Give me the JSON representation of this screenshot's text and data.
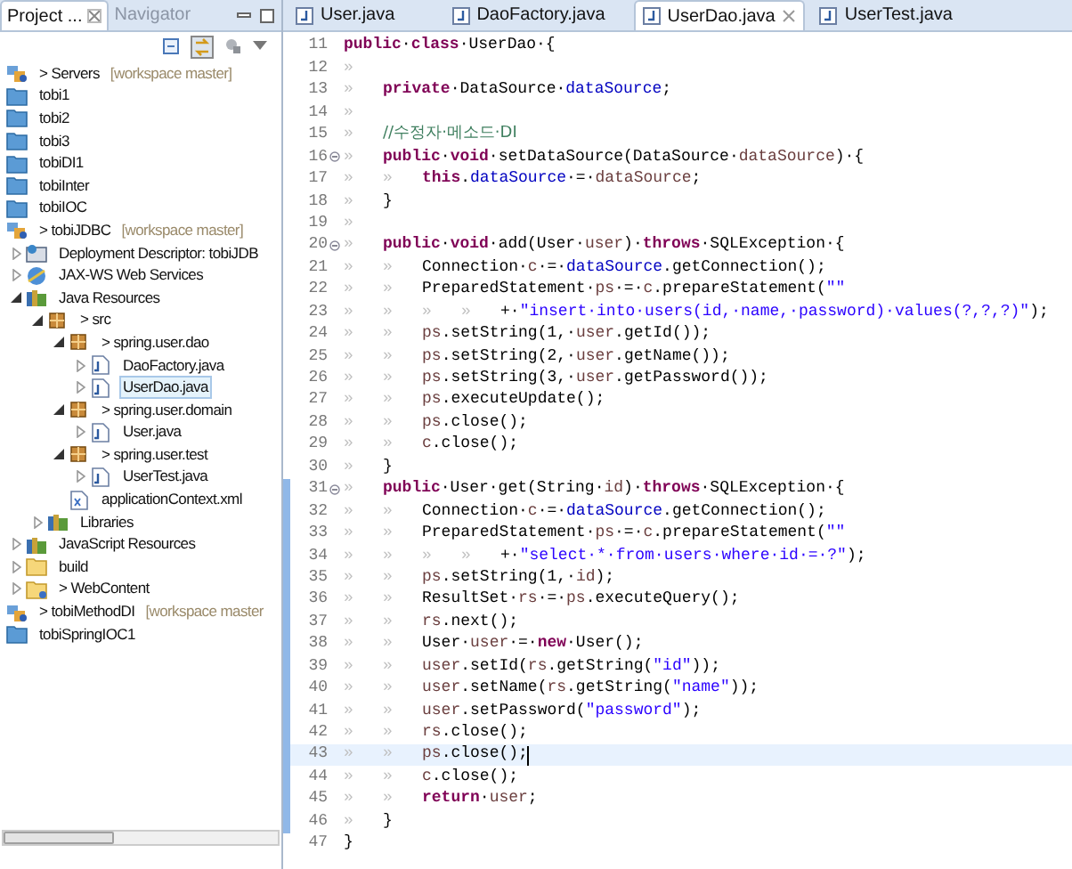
{
  "explorer": {
    "tabs": [
      {
        "label": "Project ...",
        "selected": true
      },
      {
        "label": "Navigator",
        "selected": false
      }
    ],
    "tree": [
      {
        "label": "> Servers",
        "suffix": "[workspace master]",
        "kind": "server-project"
      },
      {
        "label": "tobi1",
        "kind": "folder"
      },
      {
        "label": "tobi2",
        "kind": "folder"
      },
      {
        "label": "tobi3",
        "kind": "folder"
      },
      {
        "label": "tobiDI1",
        "kind": "folder"
      },
      {
        "label": "tobiInter",
        "kind": "folder"
      },
      {
        "label": "tobiIOC",
        "kind": "folder"
      },
      {
        "label": "> tobiJDBC",
        "suffix": "[workspace master]",
        "kind": "web-project",
        "children": [
          {
            "label": "Deployment Descriptor: tobiJDB",
            "kind": "descriptor",
            "expanded": false
          },
          {
            "label": "JAX-WS Web Services",
            "kind": "webservices",
            "expanded": false
          },
          {
            "label": "Java Resources",
            "kind": "java-resources",
            "expanded": true,
            "children": [
              {
                "label": "> src",
                "kind": "src",
                "expanded": true,
                "children": [
                  {
                    "label": "> spring.user.dao",
                    "kind": "package",
                    "expanded": true,
                    "children": [
                      {
                        "label": "DaoFactory.java",
                        "kind": "java-file",
                        "expanded": false,
                        "selected": false
                      },
                      {
                        "label": "UserDao.java",
                        "kind": "java-file",
                        "expanded": false,
                        "selected": true
                      }
                    ]
                  },
                  {
                    "label": "> spring.user.domain",
                    "kind": "package",
                    "expanded": true,
                    "children": [
                      {
                        "label": "User.java",
                        "kind": "java-file",
                        "expanded": false,
                        "selected": false
                      }
                    ]
                  },
                  {
                    "label": "> spring.user.test",
                    "kind": "package",
                    "expanded": true,
                    "children": [
                      {
                        "label": "UserTest.java",
                        "kind": "java-file",
                        "expanded": false,
                        "selected": false
                      }
                    ]
                  },
                  {
                    "label": "applicationContext.xml",
                    "kind": "xml-file"
                  }
                ]
              },
              {
                "label": "Libraries",
                "kind": "library",
                "expanded": false
              }
            ]
          },
          {
            "label": "JavaScript Resources",
            "kind": "library",
            "expanded": false
          },
          {
            "label": "build",
            "kind": "build-folder",
            "expanded": false
          },
          {
            "label": "> WebContent",
            "kind": "web-folder",
            "expanded": false
          }
        ]
      },
      {
        "label": "> tobiMethodDI",
        "suffix": "[workspace master",
        "kind": "server-project"
      },
      {
        "label": "tobiSpringIOC1",
        "kind": "folder"
      }
    ]
  },
  "editor": {
    "tabs": [
      {
        "label": "User.java",
        "selected": false
      },
      {
        "label": "DaoFactory.java",
        "selected": false
      },
      {
        "label": "UserDao.java",
        "selected": true
      },
      {
        "label": "UserTest.java",
        "selected": false
      }
    ],
    "lines": [
      {
        "number": "11",
        "fold": false,
        "range": false,
        "current": false,
        "tokens": [
          {
            "kind": "kw",
            "text": "public"
          },
          {
            "kind": "p",
            "text": "·"
          },
          {
            "kind": "kw",
            "text": "class"
          },
          {
            "kind": "p",
            "text": "·UserDao·{"
          }
        ]
      },
      {
        "number": "12",
        "fold": false,
        "range": false,
        "current": false,
        "tokens": [
          {
            "kind": "tab",
            "text": "»"
          }
        ]
      },
      {
        "number": "13",
        "fold": false,
        "range": false,
        "current": false,
        "tokens": [
          {
            "kind": "tab",
            "text": "»"
          },
          {
            "kind": "kw",
            "text": "private"
          },
          {
            "kind": "p",
            "text": "·DataSource·"
          },
          {
            "kind": "field",
            "text": "dataSource"
          },
          {
            "kind": "p",
            "text": ";"
          }
        ]
      },
      {
        "number": "14",
        "fold": false,
        "range": false,
        "current": false,
        "tokens": [
          {
            "kind": "tab",
            "text": "»"
          }
        ]
      },
      {
        "number": "15",
        "fold": false,
        "range": false,
        "current": false,
        "tokens": [
          {
            "kind": "tab",
            "text": "»"
          },
          {
            "kind": "cm",
            "text": "//수정자·메소드·DI"
          }
        ]
      },
      {
        "number": "16",
        "fold": true,
        "range": false,
        "current": false,
        "tokens": [
          {
            "kind": "tab",
            "text": "»"
          },
          {
            "kind": "kw",
            "text": "public"
          },
          {
            "kind": "p",
            "text": "·"
          },
          {
            "kind": "kw",
            "text": "void"
          },
          {
            "kind": "p",
            "text": "·setDataSource(DataSource·"
          },
          {
            "kind": "local",
            "text": "dataSource"
          },
          {
            "kind": "p",
            "text": ")·{"
          }
        ]
      },
      {
        "number": "17",
        "fold": false,
        "range": false,
        "current": false,
        "tokens": [
          {
            "kind": "tab",
            "text": "»"
          },
          {
            "kind": "tab",
            "text": "»"
          },
          {
            "kind": "kw",
            "text": "this"
          },
          {
            "kind": "p",
            "text": "."
          },
          {
            "kind": "field",
            "text": "dataSource"
          },
          {
            "kind": "p",
            "text": "·=·"
          },
          {
            "kind": "local",
            "text": "dataSource"
          },
          {
            "kind": "p",
            "text": ";"
          }
        ]
      },
      {
        "number": "18",
        "fold": false,
        "range": false,
        "current": false,
        "tokens": [
          {
            "kind": "tab",
            "text": "»"
          },
          {
            "kind": "p",
            "text": "}"
          }
        ]
      },
      {
        "number": "19",
        "fold": false,
        "range": false,
        "current": false,
        "tokens": [
          {
            "kind": "tab",
            "text": "»"
          }
        ]
      },
      {
        "number": "20",
        "fold": true,
        "range": false,
        "current": false,
        "tokens": [
          {
            "kind": "tab",
            "text": "»"
          },
          {
            "kind": "kw",
            "text": "public"
          },
          {
            "kind": "p",
            "text": "·"
          },
          {
            "kind": "kw",
            "text": "void"
          },
          {
            "kind": "p",
            "text": "·add(User·"
          },
          {
            "kind": "local",
            "text": "user"
          },
          {
            "kind": "p",
            "text": ")·"
          },
          {
            "kind": "kw",
            "text": "throws"
          },
          {
            "kind": "p",
            "text": "·SQLException·{"
          }
        ]
      },
      {
        "number": "21",
        "fold": false,
        "range": false,
        "current": false,
        "tokens": [
          {
            "kind": "tab",
            "text": "»"
          },
          {
            "kind": "tab",
            "text": "»"
          },
          {
            "kind": "p",
            "text": "Connection·"
          },
          {
            "kind": "local",
            "text": "c"
          },
          {
            "kind": "p",
            "text": "·=·"
          },
          {
            "kind": "field",
            "text": "dataSource"
          },
          {
            "kind": "p",
            "text": ".getConnection();"
          }
        ]
      },
      {
        "number": "22",
        "fold": false,
        "range": false,
        "current": false,
        "tokens": [
          {
            "kind": "tab",
            "text": "»"
          },
          {
            "kind": "tab",
            "text": "»"
          },
          {
            "kind": "p",
            "text": "PreparedStatement·"
          },
          {
            "kind": "local",
            "text": "ps"
          },
          {
            "kind": "p",
            "text": "·=·"
          },
          {
            "kind": "local",
            "text": "c"
          },
          {
            "kind": "p",
            "text": ".prepareStatement("
          },
          {
            "kind": "str",
            "text": "\"\""
          }
        ]
      },
      {
        "number": "23",
        "fold": false,
        "range": false,
        "current": false,
        "tokens": [
          {
            "kind": "tab",
            "text": "»"
          },
          {
            "kind": "tab",
            "text": "»"
          },
          {
            "kind": "tab",
            "text": "»"
          },
          {
            "kind": "tab",
            "text": "»"
          },
          {
            "kind": "p",
            "text": "+·"
          },
          {
            "kind": "str",
            "text": "\"insert·into·users(id,·name,·password)·values(?,?,?)\""
          },
          {
            "kind": "p",
            "text": ");"
          }
        ]
      },
      {
        "number": "24",
        "fold": false,
        "range": false,
        "current": false,
        "tokens": [
          {
            "kind": "tab",
            "text": "»"
          },
          {
            "kind": "tab",
            "text": "»"
          },
          {
            "kind": "local",
            "text": "ps"
          },
          {
            "kind": "p",
            "text": ".setString(1,·"
          },
          {
            "kind": "local",
            "text": "user"
          },
          {
            "kind": "p",
            "text": ".getId());"
          }
        ]
      },
      {
        "number": "25",
        "fold": false,
        "range": false,
        "current": false,
        "tokens": [
          {
            "kind": "tab",
            "text": "»"
          },
          {
            "kind": "tab",
            "text": "»"
          },
          {
            "kind": "local",
            "text": "ps"
          },
          {
            "kind": "p",
            "text": ".setString(2,·"
          },
          {
            "kind": "local",
            "text": "user"
          },
          {
            "kind": "p",
            "text": ".getName());"
          }
        ]
      },
      {
        "number": "26",
        "fold": false,
        "range": false,
        "current": false,
        "tokens": [
          {
            "kind": "tab",
            "text": "»"
          },
          {
            "kind": "tab",
            "text": "»"
          },
          {
            "kind": "local",
            "text": "ps"
          },
          {
            "kind": "p",
            "text": ".setString(3,·"
          },
          {
            "kind": "local",
            "text": "user"
          },
          {
            "kind": "p",
            "text": ".getPassword());"
          }
        ]
      },
      {
        "number": "27",
        "fold": false,
        "range": false,
        "current": false,
        "tokens": [
          {
            "kind": "tab",
            "text": "»"
          },
          {
            "kind": "tab",
            "text": "»"
          },
          {
            "kind": "local",
            "text": "ps"
          },
          {
            "kind": "p",
            "text": ".executeUpdate();"
          }
        ]
      },
      {
        "number": "28",
        "fold": false,
        "range": false,
        "current": false,
        "tokens": [
          {
            "kind": "tab",
            "text": "»"
          },
          {
            "kind": "tab",
            "text": "»"
          },
          {
            "kind": "local",
            "text": "ps"
          },
          {
            "kind": "p",
            "text": ".close();"
          }
        ]
      },
      {
        "number": "29",
        "fold": false,
        "range": false,
        "current": false,
        "tokens": [
          {
            "kind": "tab",
            "text": "»"
          },
          {
            "kind": "tab",
            "text": "»"
          },
          {
            "kind": "local",
            "text": "c"
          },
          {
            "kind": "p",
            "text": ".close();"
          }
        ]
      },
      {
        "number": "30",
        "fold": false,
        "range": false,
        "current": false,
        "tokens": [
          {
            "kind": "tab",
            "text": "»"
          },
          {
            "kind": "p",
            "text": "}"
          }
        ]
      },
      {
        "number": "31",
        "fold": true,
        "range": true,
        "current": false,
        "tokens": [
          {
            "kind": "tab",
            "text": "»"
          },
          {
            "kind": "kw",
            "text": "public"
          },
          {
            "kind": "p",
            "text": "·User·get(String·"
          },
          {
            "kind": "local",
            "text": "id"
          },
          {
            "kind": "p",
            "text": ")·"
          },
          {
            "kind": "kw",
            "text": "throws"
          },
          {
            "kind": "p",
            "text": "·SQLException·{"
          }
        ]
      },
      {
        "number": "32",
        "fold": false,
        "range": true,
        "current": false,
        "tokens": [
          {
            "kind": "tab",
            "text": "»"
          },
          {
            "kind": "tab",
            "text": "»"
          },
          {
            "kind": "p",
            "text": "Connection·"
          },
          {
            "kind": "local",
            "text": "c"
          },
          {
            "kind": "p",
            "text": "·=·"
          },
          {
            "kind": "field",
            "text": "dataSource"
          },
          {
            "kind": "p",
            "text": ".getConnection();"
          }
        ]
      },
      {
        "number": "33",
        "fold": false,
        "range": true,
        "current": false,
        "tokens": [
          {
            "kind": "tab",
            "text": "»"
          },
          {
            "kind": "tab",
            "text": "»"
          },
          {
            "kind": "p",
            "text": "PreparedStatement·"
          },
          {
            "kind": "local",
            "text": "ps"
          },
          {
            "kind": "p",
            "text": "·=·"
          },
          {
            "kind": "local",
            "text": "c"
          },
          {
            "kind": "p",
            "text": ".prepareStatement("
          },
          {
            "kind": "str",
            "text": "\"\""
          }
        ]
      },
      {
        "number": "34",
        "fold": false,
        "range": true,
        "current": false,
        "tokens": [
          {
            "kind": "tab",
            "text": "»"
          },
          {
            "kind": "tab",
            "text": "»"
          },
          {
            "kind": "tab",
            "text": "»"
          },
          {
            "kind": "tab",
            "text": "»"
          },
          {
            "kind": "p",
            "text": "+·"
          },
          {
            "kind": "str",
            "text": "\"select·*·from·users·where·id·=·?\""
          },
          {
            "kind": "p",
            "text": ");"
          }
        ]
      },
      {
        "number": "35",
        "fold": false,
        "range": true,
        "current": false,
        "tokens": [
          {
            "kind": "tab",
            "text": "»"
          },
          {
            "kind": "tab",
            "text": "»"
          },
          {
            "kind": "local",
            "text": "ps"
          },
          {
            "kind": "p",
            "text": ".setString(1,·"
          },
          {
            "kind": "local",
            "text": "id"
          },
          {
            "kind": "p",
            "text": ");"
          }
        ]
      },
      {
        "number": "36",
        "fold": false,
        "range": true,
        "current": false,
        "tokens": [
          {
            "kind": "tab",
            "text": "»"
          },
          {
            "kind": "tab",
            "text": "»"
          },
          {
            "kind": "p",
            "text": "ResultSet·"
          },
          {
            "kind": "local",
            "text": "rs"
          },
          {
            "kind": "p",
            "text": "·=·"
          },
          {
            "kind": "local",
            "text": "ps"
          },
          {
            "kind": "p",
            "text": ".executeQuery();"
          }
        ]
      },
      {
        "number": "37",
        "fold": false,
        "range": true,
        "current": false,
        "tokens": [
          {
            "kind": "tab",
            "text": "»"
          },
          {
            "kind": "tab",
            "text": "»"
          },
          {
            "kind": "local",
            "text": "rs"
          },
          {
            "kind": "p",
            "text": ".next();"
          }
        ]
      },
      {
        "number": "38",
        "fold": false,
        "range": true,
        "current": false,
        "tokens": [
          {
            "kind": "tab",
            "text": "»"
          },
          {
            "kind": "tab",
            "text": "»"
          },
          {
            "kind": "p",
            "text": "User·"
          },
          {
            "kind": "local",
            "text": "user"
          },
          {
            "kind": "p",
            "text": "·=·"
          },
          {
            "kind": "kw",
            "text": "new"
          },
          {
            "kind": "p",
            "text": "·User();"
          }
        ]
      },
      {
        "number": "39",
        "fold": false,
        "range": true,
        "current": false,
        "tokens": [
          {
            "kind": "tab",
            "text": "»"
          },
          {
            "kind": "tab",
            "text": "»"
          },
          {
            "kind": "local",
            "text": "user"
          },
          {
            "kind": "p",
            "text": ".setId("
          },
          {
            "kind": "local",
            "text": "rs"
          },
          {
            "kind": "p",
            "text": ".getString("
          },
          {
            "kind": "str",
            "text": "\"id\""
          },
          {
            "kind": "p",
            "text": "));"
          }
        ]
      },
      {
        "number": "40",
        "fold": false,
        "range": true,
        "current": false,
        "tokens": [
          {
            "kind": "tab",
            "text": "»"
          },
          {
            "kind": "tab",
            "text": "»"
          },
          {
            "kind": "local",
            "text": "user"
          },
          {
            "kind": "p",
            "text": ".setName("
          },
          {
            "kind": "local",
            "text": "rs"
          },
          {
            "kind": "p",
            "text": ".getString("
          },
          {
            "kind": "str",
            "text": "\"name\""
          },
          {
            "kind": "p",
            "text": "));"
          }
        ]
      },
      {
        "number": "41",
        "fold": false,
        "range": true,
        "current": false,
        "tokens": [
          {
            "kind": "tab",
            "text": "»"
          },
          {
            "kind": "tab",
            "text": "»"
          },
          {
            "kind": "local",
            "text": "user"
          },
          {
            "kind": "p",
            "text": ".setPassword("
          },
          {
            "kind": "str",
            "text": "\"password\""
          },
          {
            "kind": "p",
            "text": ");"
          }
        ]
      },
      {
        "number": "42",
        "fold": false,
        "range": true,
        "current": false,
        "tokens": [
          {
            "kind": "tab",
            "text": "»"
          },
          {
            "kind": "tab",
            "text": "»"
          },
          {
            "kind": "local",
            "text": "rs"
          },
          {
            "kind": "p",
            "text": ".close();"
          }
        ]
      },
      {
        "number": "43",
        "fold": false,
        "range": true,
        "current": true,
        "tokens": [
          {
            "kind": "tab",
            "text": "»"
          },
          {
            "kind": "tab",
            "text": "»"
          },
          {
            "kind": "local",
            "text": "ps"
          },
          {
            "kind": "p",
            "text": ".close();"
          }
        ]
      },
      {
        "number": "44",
        "fold": false,
        "range": true,
        "current": false,
        "tokens": [
          {
            "kind": "tab",
            "text": "»"
          },
          {
            "kind": "tab",
            "text": "»"
          },
          {
            "kind": "local",
            "text": "c"
          },
          {
            "kind": "p",
            "text": ".close();"
          }
        ]
      },
      {
        "number": "45",
        "fold": false,
        "range": true,
        "current": false,
        "tokens": [
          {
            "kind": "tab",
            "text": "»"
          },
          {
            "kind": "tab",
            "text": "»"
          },
          {
            "kind": "kw",
            "text": "return"
          },
          {
            "kind": "p",
            "text": "·"
          },
          {
            "kind": "local",
            "text": "user"
          },
          {
            "kind": "p",
            "text": ";"
          }
        ]
      },
      {
        "number": "46",
        "fold": false,
        "range": true,
        "current": false,
        "tokens": [
          {
            "kind": "tab",
            "text": "»"
          },
          {
            "kind": "p",
            "text": "}"
          }
        ]
      },
      {
        "number": "47",
        "fold": false,
        "range": false,
        "current": false,
        "tokens": [
          {
            "kind": "p",
            "text": "}"
          }
        ]
      }
    ]
  }
}
